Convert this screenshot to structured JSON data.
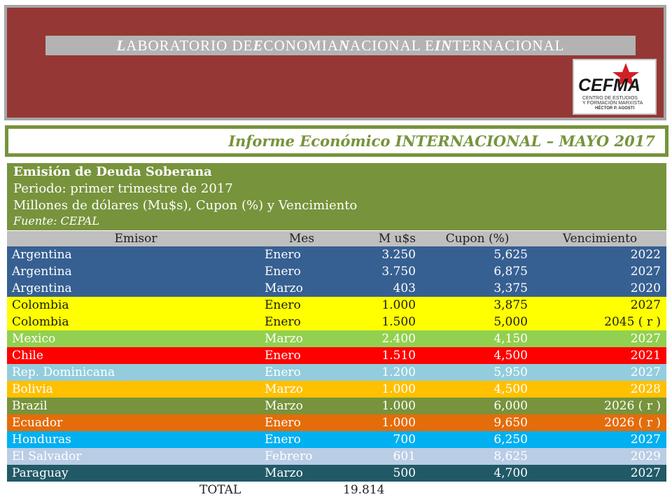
{
  "header": {
    "title_parts": [
      {
        "cap": "L",
        "rest": "ABORATORIO DE "
      },
      {
        "cap": "E",
        "rest": "CONOMIA "
      },
      {
        "cap": "N",
        "rest": "ACIONAL E "
      },
      {
        "cap": "IN",
        "rest": "TERNACIONAL"
      }
    ],
    "logo": {
      "name": "CEFMA",
      "line1": "CENTRO DE ESTUDIOS",
      "line2": "Y FORMACIÓN MARXISTA",
      "line3": "HÉCTOR P. AGOSTI",
      "star_color": "#d21f26"
    }
  },
  "subtitle": "Informe Económico INTERNACIONAL – MAYO 2017",
  "info": {
    "title": "Emisión de Deuda Soberana",
    "period": "Periodo: primer trimestre de 2017",
    "units": "Millones de dólares (Mu$s), Cupon (%) y Vencimiento",
    "source": "Fuente: CEPAL"
  },
  "table": {
    "headers": [
      "Emisor",
      "Mes",
      "M u$s",
      "Cupon (%)",
      "Vencimiento"
    ],
    "rows": [
      {
        "emisor": "Argentina",
        "mes": "Enero",
        "monto": "3.250",
        "cupon": "5,625",
        "venc": "2022",
        "bg": "#376092",
        "fg": "#ffffff"
      },
      {
        "emisor": "Argentina",
        "mes": "Enero",
        "monto": "3.750",
        "cupon": "6,875",
        "venc": "2027",
        "bg": "#376092",
        "fg": "#ffffff"
      },
      {
        "emisor": "Argentina",
        "mes": "Marzo",
        "monto": "403",
        "cupon": "3,375",
        "venc": "2020",
        "bg": "#376092",
        "fg": "#ffffff"
      },
      {
        "emisor": "Colombia",
        "mes": "Enero",
        "monto": "1.000",
        "cupon": "3,875",
        "venc": "2027",
        "bg": "#ffff00",
        "fg": "#1a1a1a"
      },
      {
        "emisor": "Colombia",
        "mes": "Enero",
        "monto": "1.500",
        "cupon": "5,000",
        "venc": "2045 ( r )",
        "bg": "#ffff00",
        "fg": "#1a1a1a"
      },
      {
        "emisor": "Mexico",
        "mes": "Marzo",
        "monto": "2.400",
        "cupon": "4,150",
        "venc": "2027",
        "bg": "#92d050",
        "fg": "#ffffff"
      },
      {
        "emisor": "Chile",
        "mes": "Enero",
        "monto": "1.510",
        "cupon": "4,500",
        "venc": "2021",
        "bg": "#ff0000",
        "fg": "#ffffff"
      },
      {
        "emisor": "Rep. Dominicana",
        "mes": "Enero",
        "monto": "1.200",
        "cupon": "5,950",
        "venc": "2027",
        "bg": "#93cddd",
        "fg": "#ffffff"
      },
      {
        "emisor": "Bolivia",
        "mes": "Marzo",
        "monto": "1.000",
        "cupon": "4,500",
        "venc": "2028",
        "bg": "#ffc000",
        "fg": "#ffffff"
      },
      {
        "emisor": "Brazil",
        "mes": "Marzo",
        "monto": "1.000",
        "cupon": "6,000",
        "venc": "2026 ( r )",
        "bg": "#77933c",
        "fg": "#ffffff"
      },
      {
        "emisor": "Ecuador",
        "mes": "Enero",
        "monto": "1.000",
        "cupon": "9,650",
        "venc": "2026 ( r )",
        "bg": "#e46c0a",
        "fg": "#ffffff"
      },
      {
        "emisor": "Honduras",
        "mes": "Enero",
        "monto": "700",
        "cupon": "6,250",
        "venc": "2027",
        "bg": "#00b0f0",
        "fg": "#ffffff"
      },
      {
        "emisor": "El Salvador",
        "mes": "Febrero",
        "monto": "601",
        "cupon": "8,625",
        "venc": "2029",
        "bg": "#b9cde5",
        "fg": "#ffffff"
      },
      {
        "emisor": "Paraguay",
        "mes": "Marzo",
        "monto": "500",
        "cupon": "4,700",
        "venc": "2027",
        "bg": "#215967",
        "fg": "#ffffff"
      }
    ],
    "total": {
      "label": "TOTAL",
      "monto": "19.814"
    }
  }
}
